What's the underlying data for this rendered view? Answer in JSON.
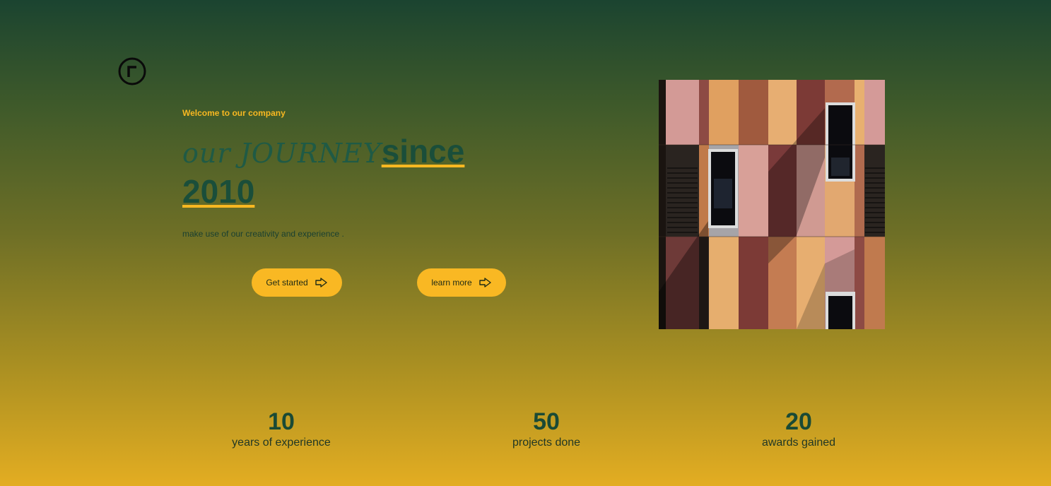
{
  "hero": {
    "welcome": "Welcome to our company",
    "headline_script": "our JOURNEY",
    "headline_bold_1": "since",
    "headline_bold_2": "2010",
    "tagline": "make use of our creativity and experience .",
    "buttons": [
      {
        "label": "Get started",
        "icon": "arrow-right-icon"
      },
      {
        "label": "learn more",
        "icon": "arrow-right-icon"
      }
    ]
  },
  "image": {
    "subject": "colorful building facade with windows"
  },
  "stats": [
    {
      "value": "10",
      "label": "years of experience"
    },
    {
      "value": "50",
      "label": "projects done"
    },
    {
      "value": "20",
      "label": "awards gained"
    }
  ],
  "colors": {
    "accent": "#f8b821",
    "heading": "#1a4e3a",
    "gradient_top": "#1b4430",
    "gradient_bottom": "#e3ad22"
  }
}
